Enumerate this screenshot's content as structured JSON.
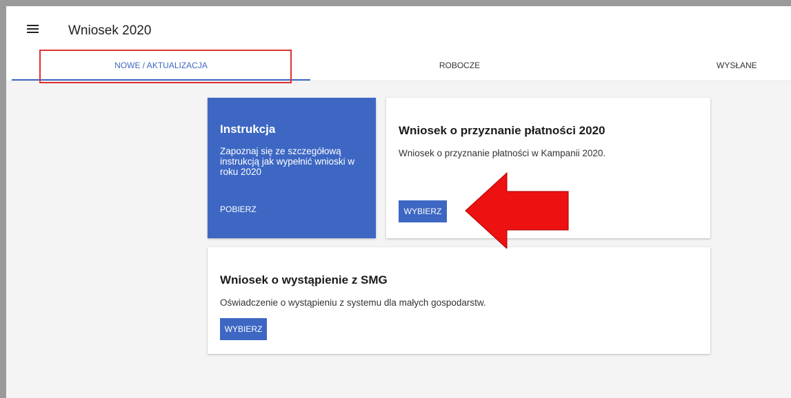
{
  "header": {
    "menu_icon": "menu-icon",
    "title": "Wniosek 2020"
  },
  "tabs": [
    {
      "label": "NOWE / AKTUALIZACJA",
      "active": true
    },
    {
      "label": "ROBOCZE",
      "active": false
    },
    {
      "label": "WYSŁANE",
      "active": false
    }
  ],
  "cards": {
    "instruction": {
      "title": "Instrukcja",
      "text": "Zapoznaj się ze szczegółową instrukcją jak wypełnić wnioski w roku 2020",
      "action": "POBIERZ"
    },
    "payment": {
      "title": "Wniosek o przyznanie płatności 2020",
      "text": "Wniosek o przyznanie płatności w Kampanii 2020.",
      "action": "WYBIERZ"
    },
    "smg": {
      "title": "Wniosek o wystąpienie z SMG",
      "text": "Oświadczenie o wystąpieniu z systemu dla małych gospodarstw.",
      "action": "WYBIERZ"
    }
  },
  "colors": {
    "primary": "#3d67c3",
    "highlight": "#e03131",
    "arrow": "#ee1111",
    "background": "#f4f4f4"
  }
}
